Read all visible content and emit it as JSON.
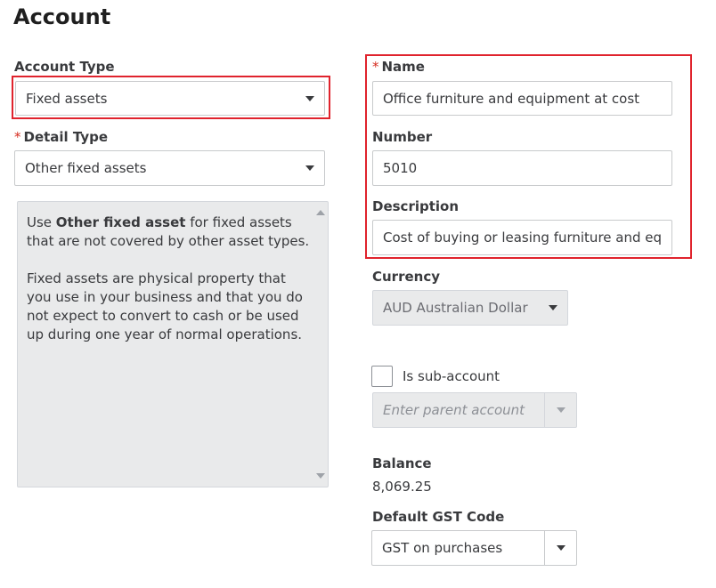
{
  "page": {
    "title": "Account"
  },
  "account_type": {
    "label": "Account Type",
    "value": "Fixed assets"
  },
  "detail_type": {
    "required_mark": "*",
    "label": "Detail Type",
    "value": "Other fixed assets"
  },
  "info": {
    "line1_pre": "Use ",
    "line1_bold": "Other fixed asset",
    "line1_post": " for fixed assets that are not covered by other asset types.",
    "paragraph2": "Fixed assets are physical property that you use in your business and that you do not expect to convert to cash or be used up during one year of normal operations."
  },
  "name": {
    "required_mark": "*",
    "label": "Name",
    "value": "Office furniture and equipment at cost"
  },
  "number": {
    "label": "Number",
    "value": "5010"
  },
  "description": {
    "label": "Description",
    "value": "Cost of buying or leasing furniture and equ"
  },
  "currency": {
    "label": "Currency",
    "value": "AUD Australian Dollar"
  },
  "sub_account": {
    "label": "Is sub-account",
    "checked": false,
    "placeholder": "Enter parent account"
  },
  "balance": {
    "label": "Balance",
    "value": "8,069.25"
  },
  "gst": {
    "label": "Default GST Code",
    "value": "GST on purchases"
  },
  "colors": {
    "highlight": "#e0232d",
    "required": "#d52b1e",
    "disabled_bg": "#e9eaeb"
  }
}
